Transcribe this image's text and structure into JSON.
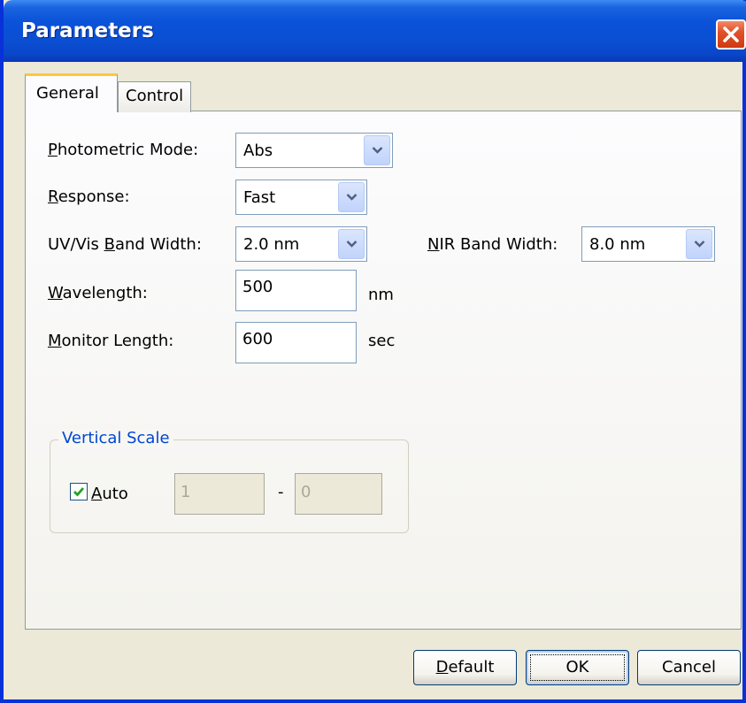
{
  "window": {
    "title": "Parameters"
  },
  "tabs": [
    {
      "label": "General",
      "active": true
    },
    {
      "label": "Control",
      "active": false
    }
  ],
  "general": {
    "photometric_mode": {
      "label_mnemonic": "P",
      "label_rest": "hotometric Mode:",
      "value": "Abs"
    },
    "response": {
      "label_mnemonic": "R",
      "label_rest": "esponse:",
      "value": "Fast"
    },
    "uvvis_bandwidth": {
      "label_pre": "UV/Vis ",
      "label_mnemonic": "B",
      "label_rest": "and Width:",
      "value": "2.0 nm"
    },
    "nir_bandwidth": {
      "label_mnemonic": "N",
      "label_rest": "IR Band Width:",
      "value": "8.0 nm"
    },
    "wavelength": {
      "label_mnemonic": "W",
      "label_rest": "avelength:",
      "value": "500",
      "unit": "nm"
    },
    "monitor_length": {
      "label_mnemonic": "M",
      "label_rest": "onitor Length:",
      "value": "600",
      "unit": "sec"
    }
  },
  "vertical_scale": {
    "title": "Vertical Scale",
    "auto": {
      "label_mnemonic": "A",
      "label_rest": "uto",
      "checked": true
    },
    "max": "1",
    "separator": "-",
    "min": "0"
  },
  "buttons": {
    "default": {
      "mnemonic": "D",
      "rest": "efault"
    },
    "ok": "OK",
    "cancel": "Cancel"
  },
  "icons": {
    "close": "close-icon",
    "dropdown": "chevron-down-icon",
    "check": "checkmark-icon"
  },
  "colors": {
    "titlebar": "#0a52d8",
    "tab_highlight": "#ffc83c",
    "group_title": "#0046d5",
    "close_button": "#e2512a"
  }
}
